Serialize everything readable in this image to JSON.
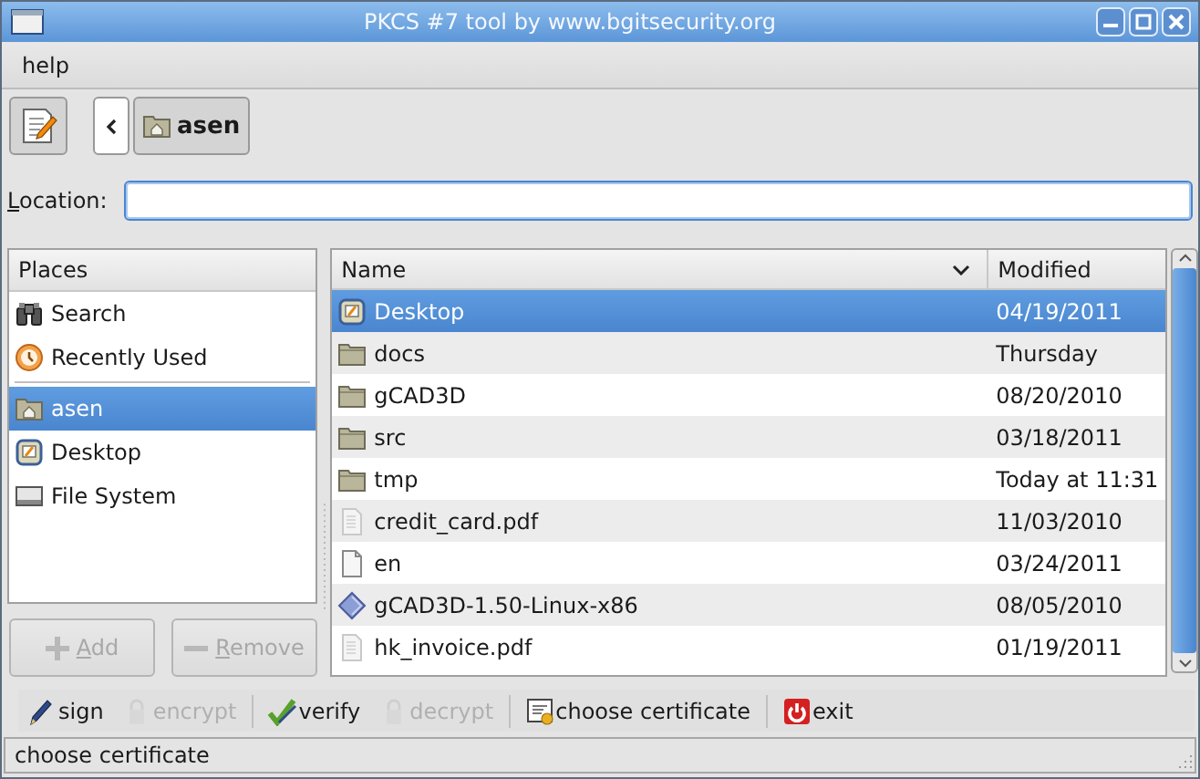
{
  "window": {
    "title": "PKCS #7 tool by www.bgitsecurity.org"
  },
  "menu": [
    {
      "label": "help"
    }
  ],
  "path_bar": {
    "segments": [
      {
        "label": "asen",
        "kind": "home",
        "selected": true
      }
    ]
  },
  "location": {
    "label": "Location:"
  },
  "places": {
    "header": "Places",
    "sections": [
      [
        {
          "label": "Search",
          "kind": "search",
          "selected": false
        },
        {
          "label": "Recently Used",
          "kind": "recent",
          "selected": false
        }
      ],
      [
        {
          "label": "asen",
          "kind": "home",
          "selected": true
        },
        {
          "label": "Desktop",
          "kind": "desktop",
          "selected": false
        },
        {
          "label": "File System",
          "kind": "drive",
          "selected": false
        }
      ]
    ],
    "buttons": [
      {
        "label": "Add",
        "disabled": true
      },
      {
        "label": "Remove",
        "disabled": true
      }
    ]
  },
  "files": {
    "columns": [
      {
        "label": "Name",
        "sorted": true
      },
      {
        "label": "Modified",
        "sorted": false
      }
    ],
    "rows": [
      {
        "name": "Desktop",
        "kind": "desktop",
        "modified": "04/19/2011",
        "selected": true
      },
      {
        "name": "docs",
        "kind": "folder",
        "modified": "Thursday",
        "selected": false
      },
      {
        "name": "gCAD3D",
        "kind": "folder",
        "modified": "08/20/2010",
        "selected": false
      },
      {
        "name": "src",
        "kind": "folder",
        "modified": "03/18/2011",
        "selected": false
      },
      {
        "name": "tmp",
        "kind": "folder",
        "modified": "Today at 11:31",
        "selected": false
      },
      {
        "name": "credit_card.pdf",
        "kind": "pdf",
        "modified": "11/03/2010",
        "selected": false
      },
      {
        "name": "en",
        "kind": "file",
        "modified": "03/24/2011",
        "selected": false
      },
      {
        "name": "gCAD3D-1.50-Linux-x86",
        "kind": "package",
        "modified": "08/05/2010",
        "selected": false
      },
      {
        "name": "hk_invoice.pdf",
        "kind": "pdf",
        "modified": "01/19/2011",
        "selected": false
      }
    ]
  },
  "toolbar": [
    [
      {
        "label": "sign",
        "kind": "pen",
        "disabled": false
      },
      {
        "label": "encrypt",
        "kind": "lock",
        "disabled": true
      }
    ],
    [
      {
        "label": "verify",
        "kind": "check",
        "disabled": false
      },
      {
        "label": "decrypt",
        "kind": "lock",
        "disabled": true
      }
    ],
    [
      {
        "label": "choose certificate",
        "kind": "cert",
        "disabled": false
      }
    ],
    [
      {
        "label": "exit",
        "kind": "power",
        "disabled": false
      }
    ]
  ],
  "status_bar": {
    "text": "choose certificate"
  }
}
